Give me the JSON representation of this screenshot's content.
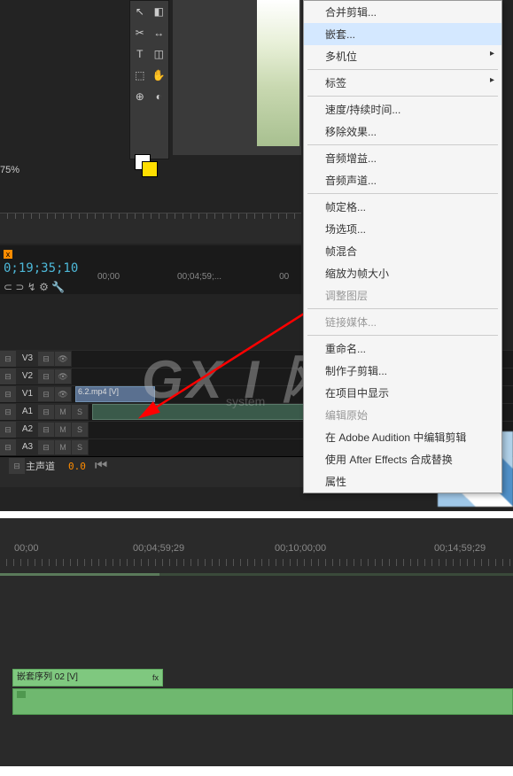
{
  "zoom": "75%",
  "timecode": "0;19;35;10",
  "time_ruler_top": [
    "00;00",
    "00;04;59;...",
    "00"
  ],
  "menu": {
    "merge_clips": "合并剪辑...",
    "nest": "嵌套...",
    "multicam": "多机位",
    "label": "标签",
    "speed_duration": "速度/持续时间...",
    "remove_effects": "移除效果...",
    "audio_gain": "音频增益...",
    "audio_channels": "音频声道...",
    "frame_hold": "帧定格...",
    "field_options": "场选项...",
    "frame_blend": "帧混合",
    "scale_to_frame": "缩放为帧大小",
    "adjustment_layer": "调整图层",
    "link_media": "链接媒体...",
    "rename": "重命名...",
    "make_subclip": "制作子剪辑...",
    "reveal_in_project": "在项目中显示",
    "edit_original": "编辑原始",
    "edit_in_audition": "在 Adobe Audition 中编辑剪辑",
    "replace_ae": "使用 After Effects 合成替换",
    "properties": "属性"
  },
  "tracks": {
    "v3": "V3",
    "v2": "V2",
    "v1": "V1",
    "a1": "A1",
    "a2": "A2",
    "a3": "A3",
    "master": "主声道",
    "master_val": "0.0"
  },
  "clips": {
    "v1_clip": "6.2.mp4 [V]"
  },
  "bottom_timeline": {
    "times": [
      "00;00",
      "00;04;59;29",
      "00;10;00;00",
      "00;14;59;29"
    ],
    "clip_label": "嵌套序列 02 [V]"
  },
  "watermark": "GX I 网"
}
